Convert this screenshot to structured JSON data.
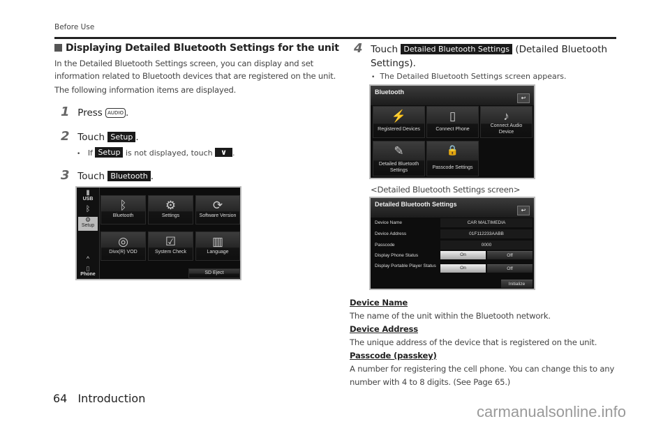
{
  "header": {
    "section": "Before Use"
  },
  "heading": "Displaying Detailed Bluetooth Settings for the unit",
  "intro": [
    "In the Detailed Bluetooth Settings screen, you can display and set",
    "information related to Bluetooth devices that are registered on the unit.",
    "The following information items are displayed."
  ],
  "steps": [
    {
      "num": "1",
      "prefix": "Press",
      "key": "AUDIO",
      "suffix": "."
    },
    {
      "num": "2",
      "prefix": "Touch",
      "button": "Setup",
      "suffix": ".",
      "note": {
        "prefix": "If",
        "button": "Setup",
        "middle": "is not displayed, touch",
        "icon_glyph": "∨",
        "suffix": "."
      }
    },
    {
      "num": "3",
      "prefix": "Touch",
      "button": "Bluetooth",
      "suffix": "."
    },
    {
      "num": "4",
      "prefix": "Touch",
      "button": "Detailed Bluetooth Settings",
      "suffix_line1": "(Detailed Bluetooth",
      "suffix_line2": "Settings).",
      "note": "The Detailed Bluetooth Settings screen appears."
    }
  ],
  "setup_screen": {
    "sidebar": [
      {
        "label": "USB",
        "icon": "usb-icon",
        "glyph": "▮"
      },
      {
        "label": "",
        "icon": "bluetooth-icon",
        "glyph": "ᛒ"
      },
      {
        "label": "Setup",
        "icon": "setup-icon",
        "glyph": "⚙"
      },
      {
        "label": "",
        "icon": "chevron-up-icon",
        "glyph": "^"
      },
      {
        "label": "Phone",
        "icon": "phone-icon",
        "glyph": "▯"
      }
    ],
    "tiles": [
      {
        "label": "Bluetooth",
        "icon": "bluetooth-icon",
        "glyph": "ᛒ"
      },
      {
        "label": "Settings",
        "icon": "wrench-gear-icon",
        "glyph": "⚙"
      },
      {
        "label": "Software Version",
        "icon": "refresh-icon",
        "glyph": "⟳"
      },
      {
        "label": "Divx(R) VOD",
        "icon": "disc-icon",
        "glyph": "◎"
      },
      {
        "label": "System Check",
        "icon": "checklist-icon",
        "glyph": "☑"
      },
      {
        "label": "Language",
        "icon": "book-icon",
        "glyph": "▥"
      }
    ],
    "eject_label": "SD Eject"
  },
  "bluetooth_screen": {
    "title": "Bluetooth",
    "back_glyph": "↩",
    "tiles": [
      {
        "label": "Registered Devices",
        "icon": "registered-devices-icon",
        "glyph": "⚡"
      },
      {
        "label": "Connect Phone",
        "icon": "phone-icon",
        "glyph": "▯"
      },
      {
        "label": "Connect Audio Device",
        "icon": "audio-device-icon",
        "glyph": "♪"
      },
      {
        "label": "Detailed Bluetooth Settings",
        "icon": "tools-icon",
        "glyph": "✎"
      },
      {
        "label": "Passcode Settings",
        "icon": "lock-icon",
        "glyph": "🔒"
      }
    ]
  },
  "caption": "<Detailed Bluetooth Settings screen>",
  "detail_screen": {
    "title": "Detailed Bluetooth Settings",
    "back_glyph": "↩",
    "rows": [
      {
        "label": "Device Name",
        "value": "CAR MALTIMEDIA"
      },
      {
        "label": "Device Address",
        "value": "01F112233AABB"
      },
      {
        "label": "Passcode",
        "value": "0000"
      }
    ],
    "toggles": [
      {
        "label": "Display Phone Status",
        "on": "On",
        "off": "Off",
        "selected": "On"
      },
      {
        "label": "Display Portable Player Status",
        "on": "On",
        "off": "Off",
        "selected": "On"
      }
    ],
    "initialize_label": "Initialize"
  },
  "definitions": [
    {
      "term": "Device Name",
      "desc": [
        "The name of the unit within the Bluetooth network."
      ]
    },
    {
      "term": "Device Address",
      "desc": [
        "The unique address of the device that is registered on the unit."
      ]
    },
    {
      "term": "Passcode (passkey)",
      "desc": [
        "A number for registering the cell phone. You can change this to any",
        "number with 4 to 8 digits. (See Page 65.)"
      ]
    }
  ],
  "footer": {
    "page_number": "64",
    "chapter": "Introduction"
  },
  "watermark": "carmanualsonline.info"
}
